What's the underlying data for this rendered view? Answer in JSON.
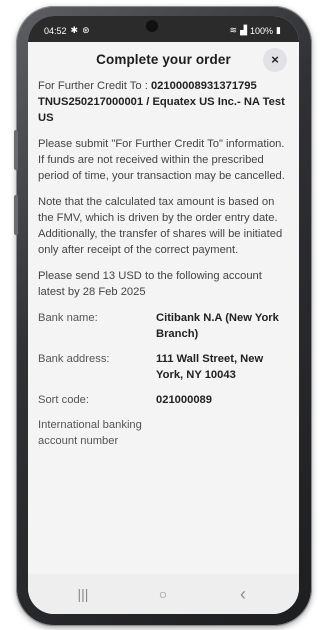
{
  "status_bar": {
    "time": "04:52",
    "battery": "100%"
  },
  "dialog": {
    "title": "Complete your order",
    "close_icon": "×",
    "for_further_credit_label": "For Further Credit To : ",
    "for_further_credit_value": "02100008931371795 TNUS250217000001 / Equatex US Inc.- NA Test US",
    "paragraph_submit": "Please submit \"For Further Credit To\" information. If funds are not received within the prescribed period of time, your transaction may be cancelled.",
    "paragraph_tax": "Note that the calculated tax amount is based on the FMV, which is driven by the order entry date. Additionally, the transfer of shares will be initiated only after receipt of the correct payment.",
    "paragraph_send": "Please send 13 USD to the following account latest by 28 Feb 2025",
    "bank_details": [
      {
        "label": "Bank name:",
        "value": "Citibank N.A (New York Branch)"
      },
      {
        "label": "Bank address:",
        "value": "111 Wall Street, New York, NY 10043"
      },
      {
        "label": "Sort code:",
        "value": "021000089"
      },
      {
        "label": "International banking account number",
        "value": ""
      }
    ]
  },
  "nav": {
    "recents_icon": "|||",
    "home_icon": "○",
    "back_icon": "‹"
  }
}
